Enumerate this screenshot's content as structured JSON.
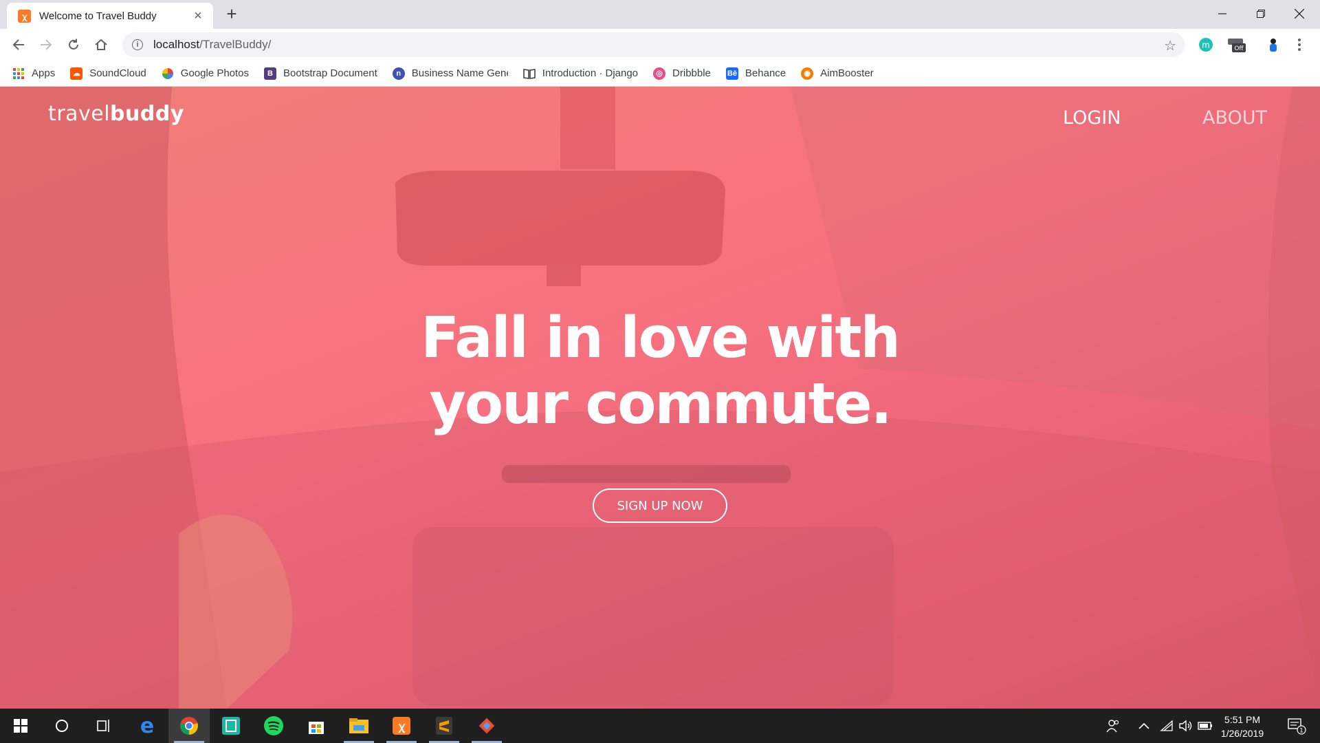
{
  "browser": {
    "tab": {
      "title": "Welcome to Travel Buddy",
      "favicon": "xampp-icon"
    },
    "new_tab_label": "+",
    "address": {
      "host": "localhost",
      "path": "/TravelBuddy/"
    },
    "bookmarks": [
      {
        "label": "Apps",
        "icon": "apps-grid-icon",
        "color": "#ea4335"
      },
      {
        "label": "SoundCloud",
        "icon": "soundcloud-icon",
        "color": "#ff5500"
      },
      {
        "label": "Google Photos",
        "icon": "google-photos-icon",
        "color": "#fbbc04"
      },
      {
        "label": "Bootstrap Document",
        "icon": "bootstrap-icon",
        "color": "#563d7c"
      },
      {
        "label": "Business Name Gene",
        "icon": "namegen-icon",
        "color": "#3f51b5"
      },
      {
        "label": "Introduction · Django",
        "icon": "book-icon",
        "color": "#3c4043"
      },
      {
        "label": "Dribbble",
        "icon": "dribbble-icon",
        "color": "#ea4c89"
      },
      {
        "label": "Behance",
        "icon": "behance-icon",
        "color": "#1769ff"
      },
      {
        "label": "AimBooster",
        "icon": "aimbooster-icon",
        "color": "#f57c00"
      }
    ],
    "extension_badge": "Off"
  },
  "page": {
    "logo": {
      "light": "travel",
      "bold": "buddy"
    },
    "nav": {
      "login": "LOGIN",
      "about": "ABOUT"
    },
    "headline": {
      "line1": "Fall in love with",
      "line2": "your commute."
    },
    "cta": "SIGN UP NOW",
    "overlay_color": "#f7707f"
  },
  "taskbar": {
    "clock": {
      "time": "5:51 PM",
      "date": "1/26/2019"
    },
    "notification_count": "1",
    "apps": [
      "start-icon",
      "cortana-icon",
      "task-view-icon",
      "edge-icon",
      "chrome-icon",
      "vysor-icon",
      "spotify-icon",
      "store-icon",
      "file-explorer-icon",
      "xampp-icon",
      "sublime-icon",
      "git-icon"
    ]
  }
}
